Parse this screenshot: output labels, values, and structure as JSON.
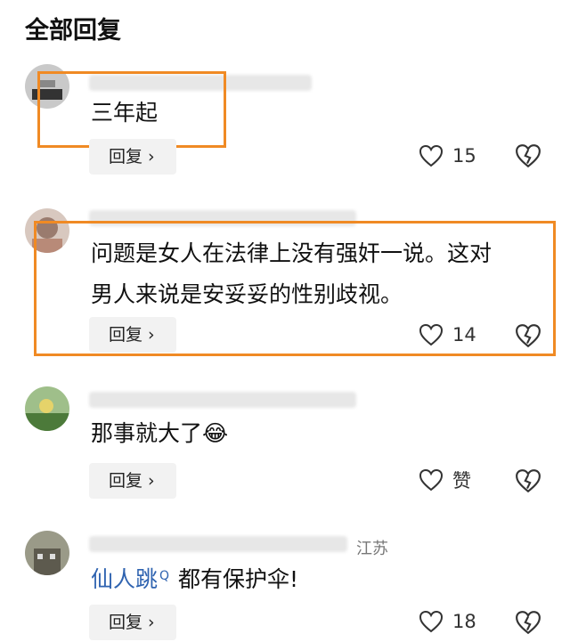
{
  "page_title": "全部回复",
  "reply_label": "回复 ›",
  "comments": [
    {
      "text": "三年起",
      "likes": "15"
    },
    {
      "text_line1": "问题是女人在法律上没有强奸一说。这对",
      "text_line2": "男人来说是安妥妥的性别歧视。",
      "likes": "14"
    },
    {
      "text": "那事就大了",
      "emoji": "😂",
      "likes": "赞"
    },
    {
      "location": "江苏",
      "link": "仙人跳",
      "text": "都有保护伞!",
      "likes": "18"
    }
  ],
  "colors": {
    "highlight": "#f08a24",
    "link": "#2f63b0"
  },
  "icons": [
    "heart-icon",
    "broken-heart-icon",
    "search-icon"
  ]
}
